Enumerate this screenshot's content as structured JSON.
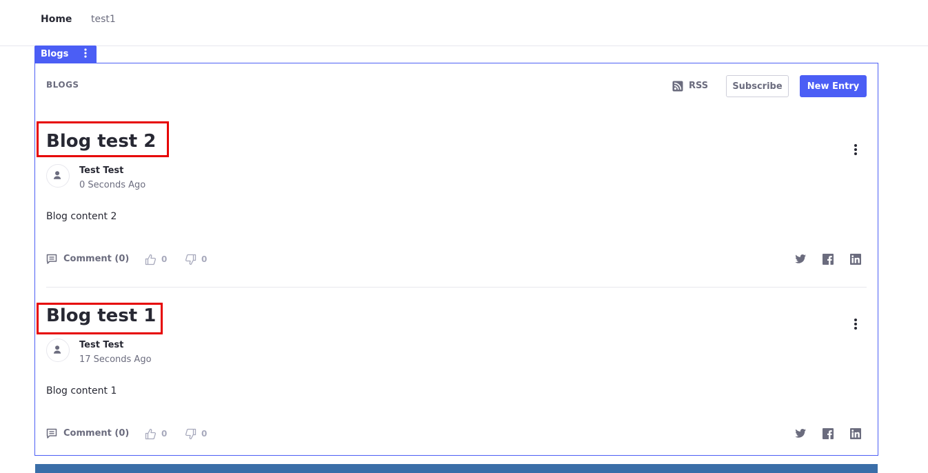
{
  "nav": {
    "items": [
      {
        "label": "Home"
      },
      {
        "label": "test1"
      }
    ]
  },
  "portlet": {
    "tab_title": "Blogs",
    "heading": "BLOGS",
    "rss_label": "RSS",
    "subscribe_label": "Subscribe",
    "new_entry_label": "New Entry"
  },
  "entries": [
    {
      "title": "Blog test 2",
      "author": "Test Test",
      "time": "0 Seconds Ago",
      "content": "Blog content 2",
      "comment_label": "Comment (0)",
      "thumbs_up": "0",
      "thumbs_down": "0"
    },
    {
      "title": "Blog test 1",
      "author": "Test Test",
      "time": "17 Seconds Ago",
      "content": "Blog content 1",
      "comment_label": "Comment (0)",
      "thumbs_up": "0",
      "thumbs_down": "0"
    }
  ],
  "colors": {
    "primary": "#4b5ef5",
    "highlight": "#e60000",
    "muted_text": "#6b6c7e",
    "footer_band": "#3a6ea8"
  },
  "icons": {
    "rss": "rss-icon",
    "comment": "comment-icon",
    "thumbs_up": "thumbs-up-icon",
    "thumbs_down": "thumbs-down-icon",
    "twitter": "twitter-icon",
    "facebook": "facebook-icon",
    "linkedin": "linkedin-icon",
    "kebab": "kebab-menu-icon",
    "user": "user-icon"
  }
}
